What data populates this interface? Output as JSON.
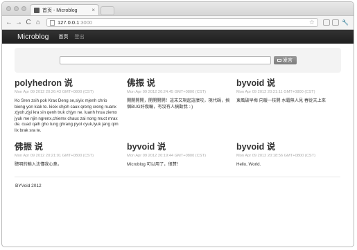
{
  "browser": {
    "tab_title": "首页 - Microblog",
    "tab_close": "×",
    "url_host": "127.0.0.1",
    "url_port": ":3000",
    "back_icon": "←",
    "forward_icon": "→",
    "reload_icon": "C",
    "home_icon": "⌂",
    "star_icon": "☆",
    "wrench_icon": "🔧"
  },
  "navbar": {
    "brand": "Microblog",
    "links": [
      {
        "label": "首页",
        "active": true
      },
      {
        "label": "登出",
        "active": false
      }
    ]
  },
  "post_form": {
    "button_label": "发言"
  },
  "posts": [
    {
      "author": "polyhedron",
      "say": "说",
      "time": "Mon Apr 09 2012 20:26:43 GMT+0800 (CST)",
      "body": "Ko Sren zsih pok Krax Deng se,siyix mjenh chrio bieng yon kiak te. kioix chjoh caux qreng creng nuanx zjyoh,zjyi kra sin qenh truk chjyn ne. luanh hrua ziemx jyuk me njin ngrenx,chiemx chaux zai nong muct mrax de. cuad qaih gho tung ghrang pyot cyuk,lyuk jang qim lix brak sra te."
    },
    {
      "author": "佛振",
      "say": "说",
      "time": "Mon Apr 09 2012 20:24:45 GMT+0800 (CST)",
      "body": "開開開開，開開開開！這末又現起這麼咬，現代碼，搞個BUG好幾輪，有沒有人搞勤我 :-)"
    },
    {
      "author": "byvoid",
      "say": "说",
      "time": "Mon Apr 09 2012 20:21:11 GMT+0800 (CST)",
      "body": "東風破早梅 向暖一枝開 水霜無人見 春從天上來"
    },
    {
      "author": "佛振",
      "say": "说",
      "time": "Mon Apr 09 2012 20:21:01 GMT+0800 (CST)",
      "body": "聰明的輸入法懂我心意。"
    },
    {
      "author": "byvoid",
      "say": "说",
      "time": "Mon Apr 09 2012 20:19:44 GMT+0800 (CST)",
      "body": "Microblog 可以用了，很贊！"
    },
    {
      "author": "byvoid",
      "say": "说",
      "time": "Mon Apr 09 2012 20:18:56 GMT+0800 (CST)",
      "body": "Hello, World."
    }
  ],
  "footer": {
    "text": "BYVoid 2012"
  }
}
